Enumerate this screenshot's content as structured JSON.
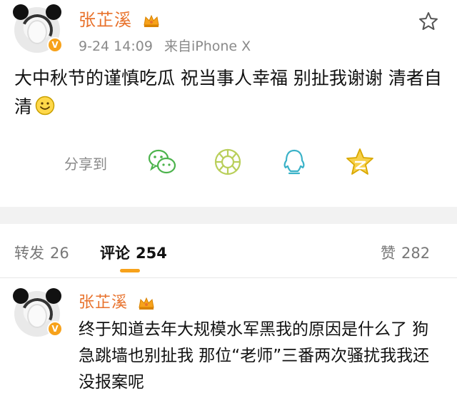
{
  "post": {
    "author": {
      "name": "张芷溪",
      "verified_badge": "V",
      "crown_icon": "crown-icon"
    },
    "timestamp": "9-24 14:09",
    "source": "来自iPhone X",
    "text": "大中秋节的谨慎吃瓜 祝当事人幸福 别扯我谢谢 清者自清",
    "emoji": "smile-emoji",
    "share": {
      "label": "分享到",
      "targets": [
        "wechat-icon",
        "moments-icon",
        "qq-icon",
        "qzone-icon"
      ]
    }
  },
  "tabs": {
    "repost": {
      "label": "转发",
      "count": "26"
    },
    "comment": {
      "label": "评论",
      "count": "254"
    },
    "like": {
      "label": "赞",
      "count": "282"
    },
    "active": "comment"
  },
  "comment": {
    "author": {
      "name": "张芷溪",
      "verified_badge": "V"
    },
    "text": "终于知道去年大规模水军黑我的原因是什么了 狗急跳墙也别扯我 那位“老师”三番两次骚扰我我还没报案呢"
  },
  "colors": {
    "username": "#e8722c",
    "accent": "#f7a21b",
    "muted": "#8a8a8a"
  }
}
